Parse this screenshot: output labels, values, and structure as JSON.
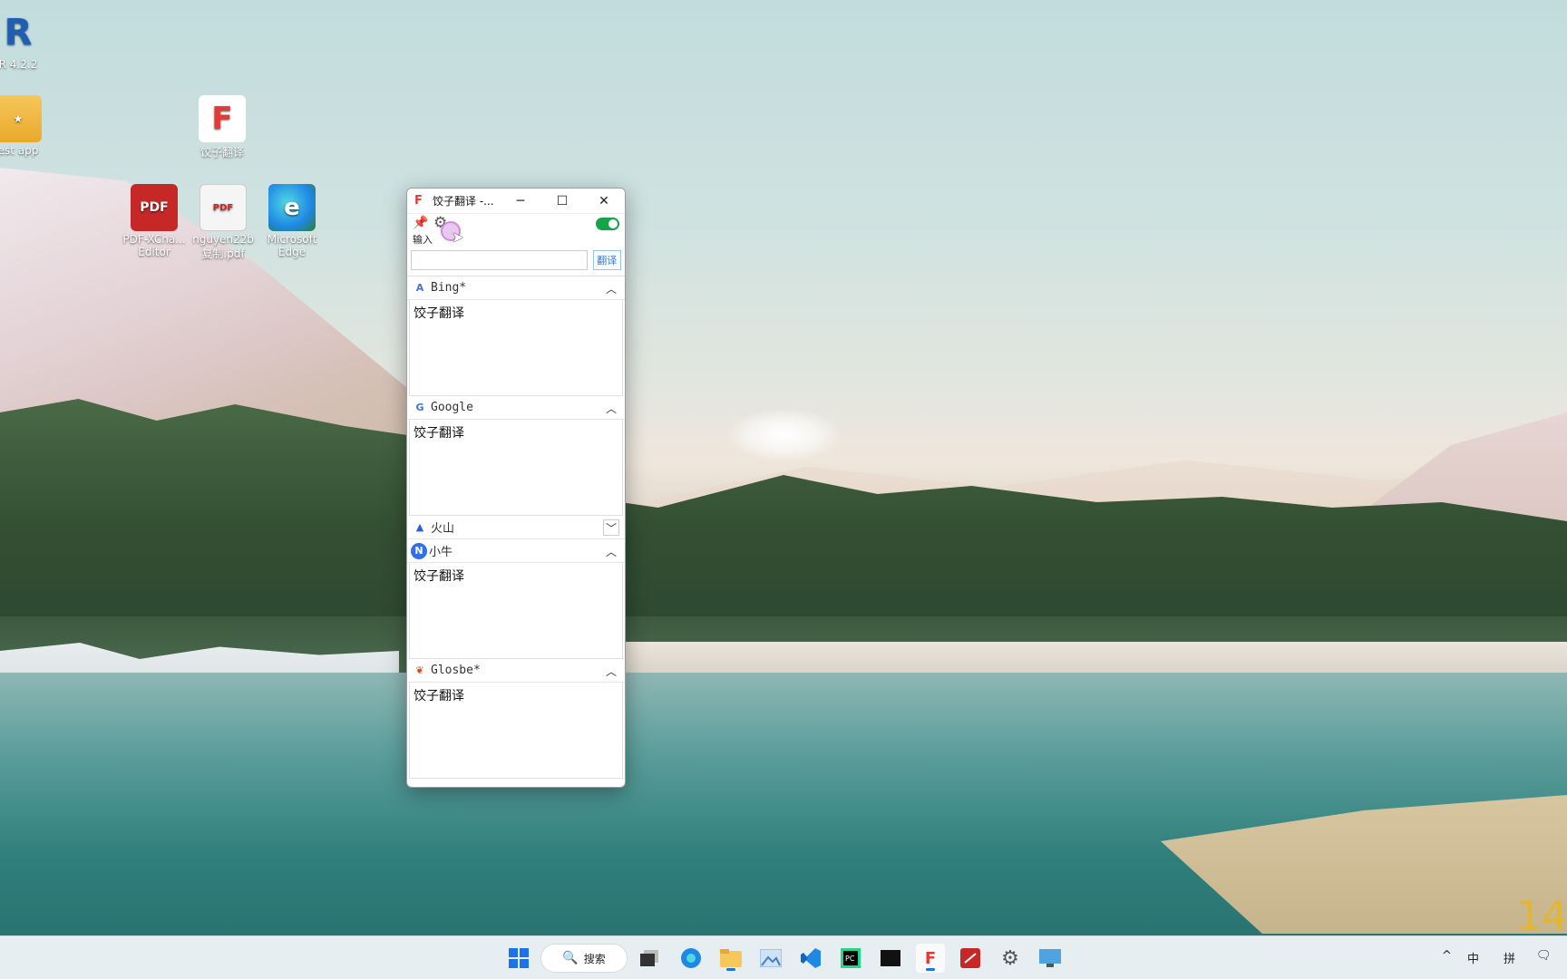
{
  "desktop": {
    "icons": [
      {
        "label": "R 4.2.2",
        "glyph": "R",
        "icon": "r-icon"
      },
      {
        "label": "est app",
        "glyph": "★",
        "icon": "folder-icon"
      },
      {
        "label": "饺子翻译",
        "glyph": "F",
        "icon": "app-f-icon"
      },
      {
        "label": "PDF-XCha... Editor",
        "glyph": "PDF",
        "icon": "pdf-editor-icon"
      },
      {
        "label": "nguyen22b 复制.pdf",
        "glyph": "PDF",
        "icon": "pdf-file-icon"
      },
      {
        "label": "Microsoft Edge",
        "glyph": "e",
        "icon": "edge-icon"
      }
    ],
    "corner_text": "14"
  },
  "window": {
    "app_logo": "F",
    "title": "饺子翻译 -...",
    "minimize": "─",
    "maximize": "☐",
    "close": "✕",
    "toggle_on": true,
    "input_label": "输入",
    "input_value": "",
    "translate_button": "翻译",
    "sections": [
      {
        "name": "Bing*",
        "icon_text": "A",
        "chevron": "︿",
        "result": "饺子翻译",
        "expanded": true
      },
      {
        "name": "Google",
        "icon_text": "G",
        "chevron": "︿",
        "result": "饺子翻译",
        "expanded": true
      },
      {
        "name": "火山",
        "icon_text": "▲",
        "chevron": "﹀",
        "result": "",
        "expanded": false
      },
      {
        "name": "小牛",
        "icon_text": "N",
        "chevron": "︿",
        "result": "饺子翻译",
        "expanded": true
      },
      {
        "name": "Glosbe*",
        "icon_text": "❦",
        "chevron": "︿",
        "result": "饺子翻译",
        "expanded": true
      }
    ]
  },
  "taskbar": {
    "search_label": "搜索",
    "apps": [
      "start",
      "file-explorer",
      "edge",
      "files",
      "photos",
      "vscode",
      "pycharm",
      "terminal",
      "jiaozi-translate",
      "pdf-xchange",
      "settings",
      "remote-desktop"
    ],
    "tray": {
      "chevron": "^",
      "ime_lang": "中",
      "ime_mode": "拼"
    }
  },
  "colors": {
    "toggle_on": "#17a34a",
    "accent": "#1a73e8",
    "logo_red": "#e53935"
  }
}
